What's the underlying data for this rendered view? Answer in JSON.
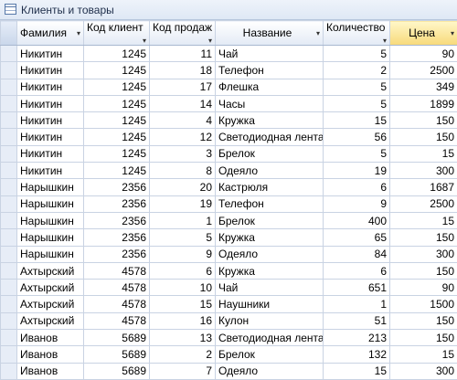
{
  "window": {
    "title": "Клиенты и товары",
    "icon": "table-icon"
  },
  "columns": [
    {
      "label": "Фамилия",
      "icon": "dropdown-arrow-icon"
    },
    {
      "label": "Код клиент",
      "icon": "dropdown-arrow-icon"
    },
    {
      "label": "Код продаж",
      "icon": "dropdown-arrow-icon"
    },
    {
      "label": "Название",
      "icon": "dropdown-arrow-icon"
    },
    {
      "label": "Количество",
      "icon": "dropdown-arrow-icon"
    },
    {
      "label": "Цена",
      "icon": "dropdown-arrow-icon"
    }
  ],
  "highlight_color": "#f7d97a",
  "rows": [
    [
      "Никитин",
      "1245",
      "11",
      "Чай",
      "5",
      "90"
    ],
    [
      "Никитин",
      "1245",
      "18",
      "Телефон",
      "2",
      "2500"
    ],
    [
      "Никитин",
      "1245",
      "17",
      "Флешка",
      "5",
      "349"
    ],
    [
      "Никитин",
      "1245",
      "14",
      "Часы",
      "5",
      "1899"
    ],
    [
      "Никитин",
      "1245",
      "4",
      "Кружка",
      "15",
      "150"
    ],
    [
      "Никитин",
      "1245",
      "12",
      "Светодиодная лента",
      "56",
      "150"
    ],
    [
      "Никитин",
      "1245",
      "3",
      "Брелок",
      "5",
      "15"
    ],
    [
      "Никитин",
      "1245",
      "8",
      "Одеяло",
      "19",
      "300"
    ],
    [
      "Нарышкин",
      "2356",
      "20",
      "Кастрюля",
      "6",
      "1687"
    ],
    [
      "Нарышкин",
      "2356",
      "19",
      "Телефон",
      "9",
      "2500"
    ],
    [
      "Нарышкин",
      "2356",
      "1",
      "Брелок",
      "400",
      "15"
    ],
    [
      "Нарышкин",
      "2356",
      "5",
      "Кружка",
      "65",
      "150"
    ],
    [
      "Нарышкин",
      "2356",
      "9",
      "Одеяло",
      "84",
      "300"
    ],
    [
      "Ахтырский",
      "4578",
      "6",
      "Кружка",
      "6",
      "150"
    ],
    [
      "Ахтырский",
      "4578",
      "10",
      "Чай",
      "651",
      "90"
    ],
    [
      "Ахтырский",
      "4578",
      "15",
      "Наушники",
      "1",
      "1500"
    ],
    [
      "Ахтырский",
      "4578",
      "16",
      "Кулон",
      "51",
      "150"
    ],
    [
      "Иванов",
      "5689",
      "13",
      "Светодиодная лента",
      "213",
      "150"
    ],
    [
      "Иванов",
      "5689",
      "2",
      "Брелок",
      "132",
      "15"
    ],
    [
      "Иванов",
      "5689",
      "7",
      "Одеяло",
      "15",
      "300"
    ]
  ]
}
